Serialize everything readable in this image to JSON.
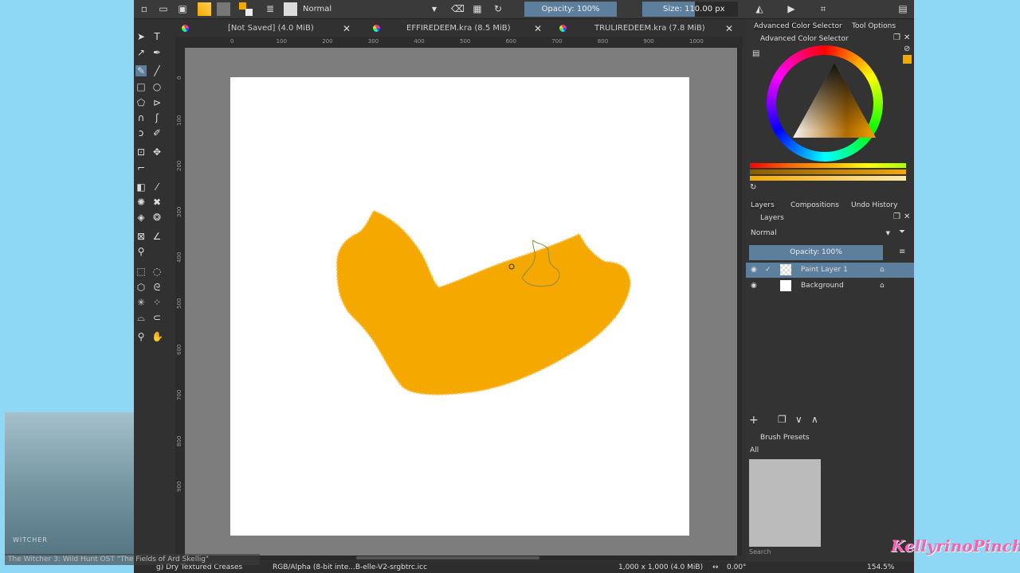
{
  "toolbar": {
    "blend_mode": "Normal",
    "opacity": "Opacity: 100%",
    "size": "Size: 110.00 px",
    "fg_color": "#f5a800",
    "bg_color": "#7a7a7a"
  },
  "tabs": [
    {
      "label": "[Not Saved]  (4.0 MiB)"
    },
    {
      "label": "EFFIREDEEM.kra (8.5 MiB)"
    },
    {
      "label": "TRULIREDEEM.kra (7.8 MiB)"
    }
  ],
  "ruler": {
    "top": [
      "0",
      "100",
      "200",
      "300",
      "400",
      "500",
      "600",
      "700",
      "800",
      "900",
      "1000"
    ],
    "left": [
      "0",
      "100",
      "200",
      "300",
      "400",
      "500",
      "600",
      "700",
      "800",
      "900"
    ]
  },
  "canvas": {
    "paint_color": "#f5a800"
  },
  "status": {
    "brush": "g) Dry Textured Creases",
    "colorspace": "RGB/Alpha (8-bit inte...B-elle-V2-srgbtrc.icc",
    "dimensions": "1,000 x 1,000 (4.0 MiB)",
    "rotation": "0.00°",
    "zoom": "154.5%"
  },
  "docker": {
    "top_tabs": [
      "Advanced Color Selector",
      "Tool Options"
    ],
    "color_panel_title": "Advanced Color Selector",
    "layer_tabs": [
      "Layers",
      "Compositions",
      "Undo History"
    ],
    "layers_title": "Layers",
    "layer_blend": "Normal",
    "layer_opacity": "Opacity:  100%",
    "layers": [
      {
        "name": "Paint Layer 1"
      },
      {
        "name": "Background"
      }
    ],
    "presets_title": "Brush Presets",
    "presets_filter": "All",
    "search_placeholder": "Search"
  },
  "overlay": {
    "now_playing": "The Witcher 3: Wild Hunt OST \"The Fields of Ard Skellig\"",
    "game_logo": "WITCHER",
    "streamer_logo": "KellyrinoPinch"
  }
}
